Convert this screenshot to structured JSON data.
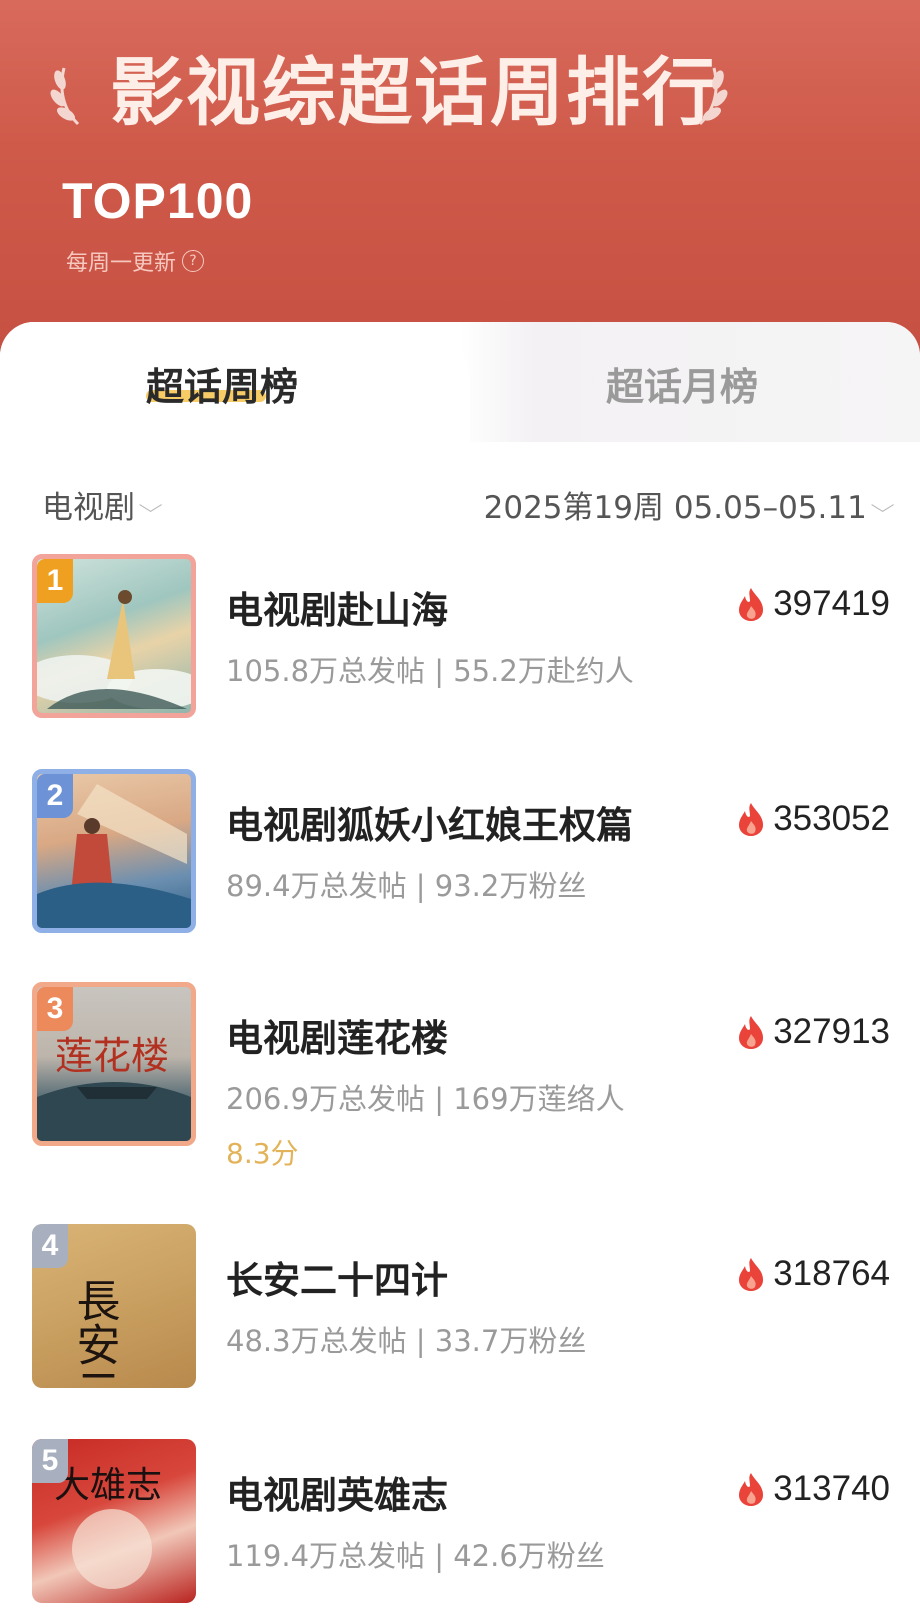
{
  "header": {
    "title": "影视综超话周排行",
    "top_label": "TOP100",
    "update_note": "每周一更新",
    "help_icon": "?"
  },
  "tabs": [
    {
      "label": "超话周榜",
      "active": true
    },
    {
      "label": "超话月榜",
      "active": false
    }
  ],
  "filters": {
    "category": "电视剧",
    "period": "2025第19周 05.05–05.11"
  },
  "colors": {
    "header_red": "#cf5a4a",
    "rank_gold": "#f0a020",
    "rank_blue": "#6e92d6",
    "rank_orange": "#ec8a5c",
    "rank_gray": "#a8b0c0",
    "heat_flame": "#e9433a",
    "score_gold": "#e3b35a"
  },
  "rankings": [
    {
      "rank": "1",
      "name": "电视剧赴山海",
      "stats": "105.8万总发帖 | 55.2万赴约人",
      "score": "",
      "heat": "397419"
    },
    {
      "rank": "2",
      "name": "电视剧狐妖小红娘王权篇",
      "stats": "89.4万总发帖 | 93.2万粉丝",
      "score": "",
      "heat": "353052"
    },
    {
      "rank": "3",
      "name": "电视剧莲花楼",
      "stats": "206.9万总发帖 | 169万莲络人",
      "score": "8.3分",
      "heat": "327913"
    },
    {
      "rank": "4",
      "name": "长安二十四计",
      "stats": "48.3万总发帖 | 33.7万粉丝",
      "score": "",
      "heat": "318764"
    },
    {
      "rank": "5",
      "name": "电视剧英雄志",
      "stats": "119.4万总发帖 | 42.6万粉丝",
      "score": "",
      "heat": "313740"
    }
  ],
  "posters": [
    {
      "art_text": ""
    },
    {
      "art_text": ""
    },
    {
      "art_text": "莲花楼"
    },
    {
      "art_text": "長安二十四計"
    },
    {
      "art_text": "大雄志"
    }
  ]
}
